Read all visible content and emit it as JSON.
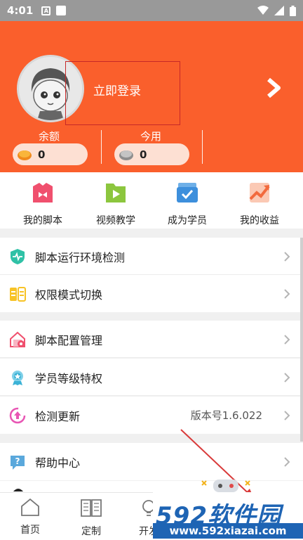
{
  "status_bar": {
    "time": "4:01",
    "notif_a": "A"
  },
  "header": {
    "login_label": "立即登录",
    "balance_label": "余额",
    "balance_value": "0",
    "today_label": "今用",
    "today_value": "0"
  },
  "actions": [
    {
      "label": "我的脚本",
      "icon": "script-icon"
    },
    {
      "label": "视频教学",
      "icon": "video-icon"
    },
    {
      "label": "成为学员",
      "icon": "student-icon"
    },
    {
      "label": "我的收益",
      "icon": "earnings-icon"
    }
  ],
  "menu": {
    "env_check": "脚本运行环境检测",
    "permission_mode": "权限模式切换",
    "script_config": "脚本配置管理",
    "member_privilege": "学员等级特权",
    "check_update": "检测更新",
    "version": "版本号1.6.022",
    "help_center": "帮助中心"
  },
  "bottom_nav": [
    {
      "label": "首页"
    },
    {
      "label": "定制"
    },
    {
      "label": "开发"
    }
  ],
  "watermark": {
    "logo_num": "592",
    "logo_text": "软件园",
    "url": "www.592xiazai.com"
  },
  "colors": {
    "header_bg": "#fa5f2c",
    "status_bar": "#999999",
    "accent_blue": "#1e64b4"
  }
}
